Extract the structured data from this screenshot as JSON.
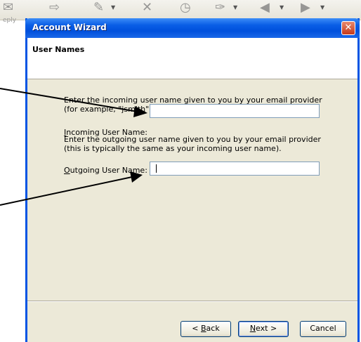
{
  "background": {
    "reply_ghost": "eply",
    "toolbar_icons": [
      "envelope-icon",
      "forward-icon",
      "brush-icon",
      "delete-icon",
      "clock-icon",
      "tag-icon",
      "back-icon",
      "forward-nav-icon"
    ]
  },
  "dialog": {
    "title": "Account Wizard",
    "close_glyph": "✕",
    "page_title": "User Names",
    "incoming": {
      "instruction": "Enter the incoming user name given to you by your email provider (for example, \"jsmith\").",
      "label_accel": "I",
      "label_rest": "ncoming User Name:",
      "value": ""
    },
    "outgoing": {
      "instruction": "Enter the outgoing user name given to you by your email provider (this is typically the same as your incoming user name).",
      "label_accel": "O",
      "label_rest": "utgoing User Name:",
      "value": ""
    },
    "buttons": {
      "back_prefix": "< ",
      "back_accel": "B",
      "back_rest": "ack",
      "next_accel": "N",
      "next_rest": "ext >",
      "cancel": "Cancel"
    }
  },
  "colors": {
    "titlebar": "#0054e3",
    "dialog_bg": "#ece9d8",
    "close_button": "#c5391a"
  }
}
